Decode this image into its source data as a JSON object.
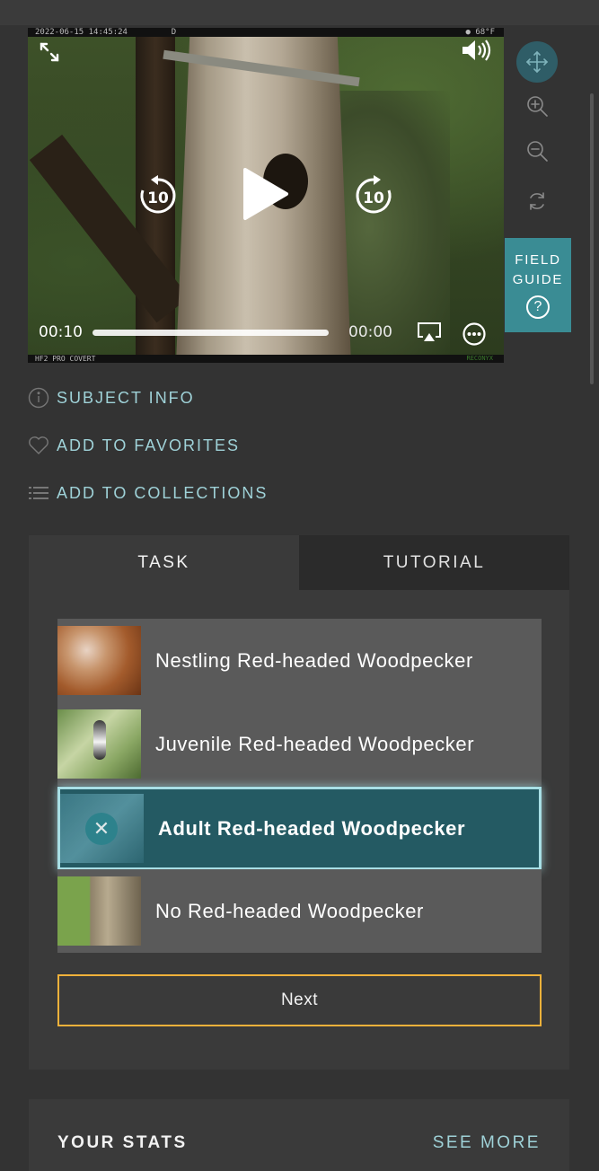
{
  "camera": {
    "timestamp": "2022-06-15 14:45:24",
    "mode": "D",
    "temperature": "68°F",
    "model": "HF2 PRO COVERT",
    "brand": "RECONYX"
  },
  "player": {
    "elapsed": "00:10",
    "remaining": "00:00",
    "skip_seconds": "10",
    "progress": 1.0
  },
  "toolbar": {
    "field_guide_line1": "FIELD",
    "field_guide_line2": "GUIDE",
    "field_guide_help": "?",
    "tools": [
      "move-icon",
      "zoom-in-icon",
      "zoom-out-icon",
      "rotate-icon"
    ],
    "active_tool": "move"
  },
  "meta_links": {
    "subject_info": "SUBJECT INFO",
    "favorites": "ADD TO FAVORITES",
    "collections": "ADD TO COLLECTIONS"
  },
  "tabs": {
    "task": "TASK",
    "tutorial": "TUTORIAL",
    "active": "task"
  },
  "choices": [
    {
      "label": "Nestling Red-headed Woodpecker",
      "selected": false
    },
    {
      "label": "Juvenile Red-headed Woodpecker",
      "selected": false
    },
    {
      "label": "Adult Red-headed Woodpecker",
      "selected": true
    },
    {
      "label": "No Red-headed Woodpecker",
      "selected": false
    }
  ],
  "next_label": "Next",
  "stats": {
    "title": "YOUR STATS",
    "see_more": "SEE MORE"
  },
  "colors": {
    "accent_teal": "#3a8c94",
    "link_text": "#9fd2d8",
    "selected_bg": "#245a63",
    "next_border": "#f0b13a",
    "background": "#333333"
  }
}
